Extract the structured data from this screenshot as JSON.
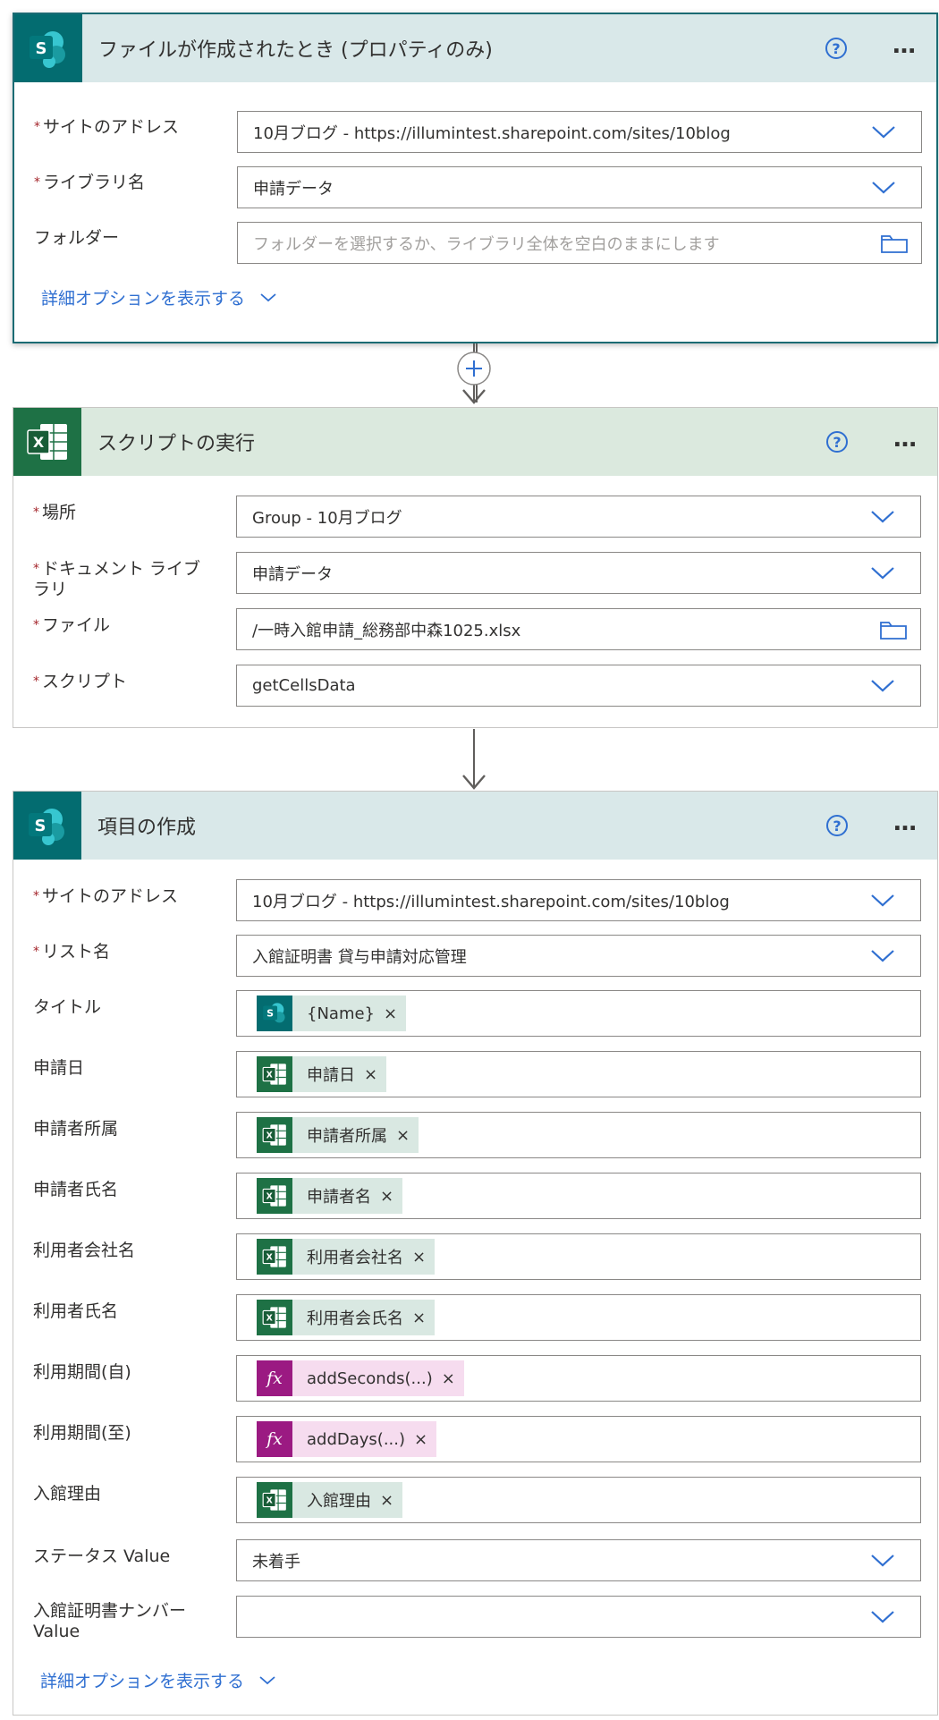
{
  "colors": {
    "sharepoint": "#036c70",
    "excel": "#1e7145",
    "expression": "#9b1a82",
    "link": "#2f6fd1",
    "required": "#a4262c"
  },
  "trigger": {
    "title": "ファイルが作成されたとき (プロパティのみ)",
    "icon": "sharepoint-icon",
    "help": "?",
    "more": "…",
    "fields": {
      "site": {
        "required_mark": "*",
        "label": "サイトのアドレス",
        "value": "10月ブログ - https://illumintest.sharepoint.com/sites/10blog"
      },
      "library": {
        "required_mark": "*",
        "label": "ライブラリ名",
        "value": "申請データ"
      },
      "folder": {
        "label": "フォルダー",
        "placeholder": "フォルダーを選択するか、ライブラリ全体を空白のままにします"
      }
    },
    "advanced": "詳細オプションを表示する"
  },
  "connector1": {
    "add": "+"
  },
  "script_action": {
    "title": "スクリプトの実行",
    "icon": "excel-icon",
    "help": "?",
    "more": "…",
    "fields": {
      "location": {
        "required_mark": "*",
        "label": "場所",
        "value": "Group - 10月ブログ"
      },
      "doclib": {
        "required_mark": "*",
        "label": "ドキュメント ライブラリ",
        "value": "申請データ"
      },
      "file": {
        "required_mark": "*",
        "label": "ファイル",
        "value": "/一時入館申請_総務部中森1025.xlsx"
      },
      "script": {
        "required_mark": "*",
        "label": "スクリプト",
        "value": "getCellsData"
      }
    }
  },
  "create_item": {
    "title": "項目の作成",
    "icon": "sharepoint-icon",
    "help": "?",
    "more": "…",
    "fields": {
      "site": {
        "required_mark": "*",
        "label": "サイトのアドレス",
        "value": "10月ブログ - https://illumintest.sharepoint.com/sites/10blog"
      },
      "list": {
        "required_mark": "*",
        "label": "リスト名",
        "value": "入館証明書 貸与申請対応管理"
      },
      "title": {
        "label": "タイトル",
        "token": "{Name}",
        "token_type": "sharepoint"
      },
      "apply_date": {
        "label": "申請日",
        "token": "申請日",
        "token_type": "excel"
      },
      "applicant_dept": {
        "label": "申請者所属",
        "token": "申請者所属",
        "token_type": "excel"
      },
      "applicant_name": {
        "label": "申請者氏名",
        "token": "申請者名",
        "token_type": "excel"
      },
      "user_company": {
        "label": "利用者会社名",
        "token": "利用者会社名",
        "token_type": "excel"
      },
      "user_name": {
        "label": "利用者氏名",
        "token": "利用者会氏名",
        "token_type": "excel"
      },
      "period_from": {
        "label": "利用期間(自)",
        "token": "addSeconds(...)",
        "token_type": "expression"
      },
      "period_to": {
        "label": "利用期間(至)",
        "token": "addDays(...)",
        "token_type": "expression"
      },
      "reason": {
        "label": "入館理由",
        "token": "入館理由",
        "token_type": "excel"
      },
      "status": {
        "label": "ステータス Value",
        "value": "未着手"
      },
      "cert_number": {
        "label": "入館証明書ナンバー Value",
        "value": ""
      }
    },
    "token_remove": "×",
    "advanced": "詳細オプションを表示する"
  }
}
